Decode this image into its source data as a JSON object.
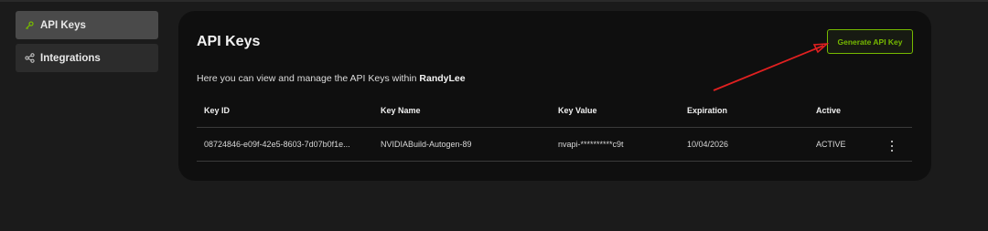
{
  "sidebar": {
    "items": [
      {
        "label": "API Keys",
        "icon": "key-icon",
        "active": true
      },
      {
        "label": "Integrations",
        "icon": "share-nodes-icon",
        "active": false
      }
    ]
  },
  "panel": {
    "title": "API Keys",
    "generate_button_label": "Generate API Key",
    "description_prefix": "Here you can view and manage the API Keys within ",
    "org_name": "RandyLee"
  },
  "table": {
    "headers": [
      "Key ID",
      "Key Name",
      "Key Value",
      "Expiration",
      "Active"
    ],
    "rows": [
      {
        "key_id": "08724846-e09f-42e5-8603-7d07b0f1e...",
        "key_name": "NVIDIABuild-Autogen-89",
        "key_value": "nvapi-**********c9t",
        "expiration": "10/04/2026",
        "active": "ACTIVE"
      }
    ]
  },
  "colors": {
    "accent": "#76b900",
    "annotation_arrow": "#e02020"
  }
}
